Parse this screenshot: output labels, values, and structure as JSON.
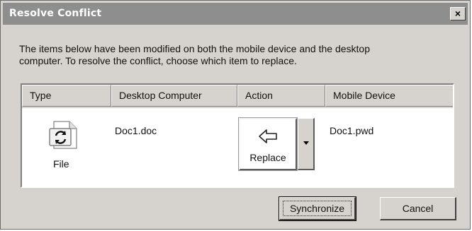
{
  "window": {
    "title": "Resolve Conflict",
    "close_glyph": "×"
  },
  "message": {
    "line1": "The items below have been modified on both the mobile device and the desktop",
    "line2": "computer. To resolve the conflict, choose which item to replace."
  },
  "list": {
    "columns": [
      "Type",
      "Desktop Computer",
      "Action",
      "Mobile Device"
    ],
    "row": {
      "type_icon": "sync-file-icon",
      "type_label": "File",
      "desktop_item": "Doc1.doc",
      "action_icon": "arrow-left-icon",
      "action_label": "Replace",
      "mobile_item": "Doc1.pwd"
    }
  },
  "buttons": {
    "synchronize": "Synchronize",
    "cancel": "Cancel"
  }
}
